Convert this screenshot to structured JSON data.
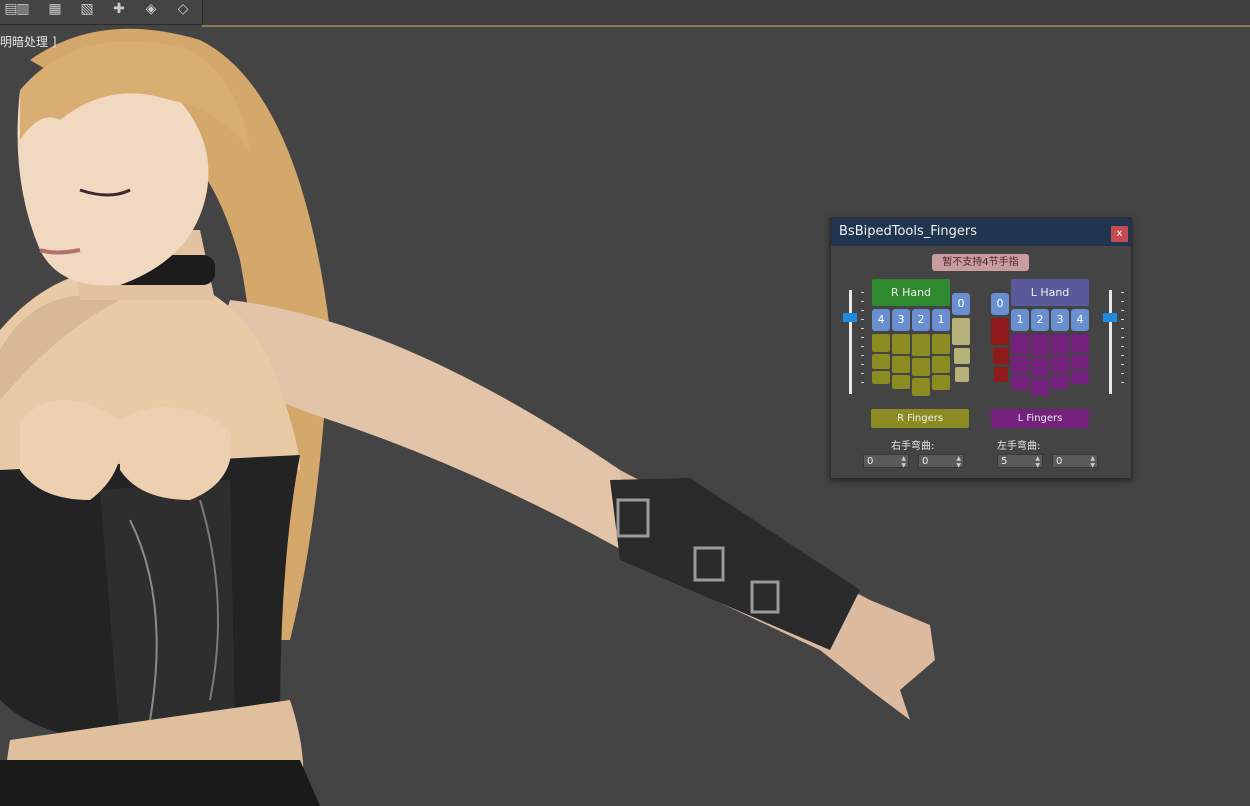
{
  "viewport": {
    "label": "明暗处理 ]"
  },
  "toolbar": {
    "icons": [
      "layer-icon",
      "layers-stack-icon",
      "layer-add-icon",
      "layer-list-icon",
      "add-layer-icon",
      "layer-arrows-icon",
      "layer-manager-icon"
    ]
  },
  "dialog": {
    "title": "BsBipedTools_Fingers",
    "close_label": "x",
    "notice_label": "暂不支持4节手指",
    "right": {
      "hand_label": "R Hand",
      "finger_numbers": [
        "4",
        "3",
        "2",
        "1"
      ],
      "thumb_number": "0",
      "fingers_label": "R Fingers",
      "bend_label": "右手弯曲:",
      "bend_values": [
        "0",
        "0"
      ]
    },
    "left": {
      "hand_label": "L Hand",
      "finger_numbers": [
        "1",
        "2",
        "3",
        "4"
      ],
      "thumb_number": "0",
      "fingers_label": "L Fingers",
      "bend_label": "左手弯曲:",
      "bend_values": [
        "5",
        "0"
      ]
    },
    "colors": {
      "title_bar": "#1f3550",
      "close": "#c44c50",
      "r_hand": "#2f8a2f",
      "l_hand": "#5a5a9a",
      "finger_number": "#6a8fd0",
      "r_segments": "#8a8c22",
      "r_thumb_segments": "#b7b27a",
      "l_segments": "#74217e",
      "l_thumb_segments": "#8e1a1a",
      "slider_thumb": "#1e8be0"
    }
  }
}
